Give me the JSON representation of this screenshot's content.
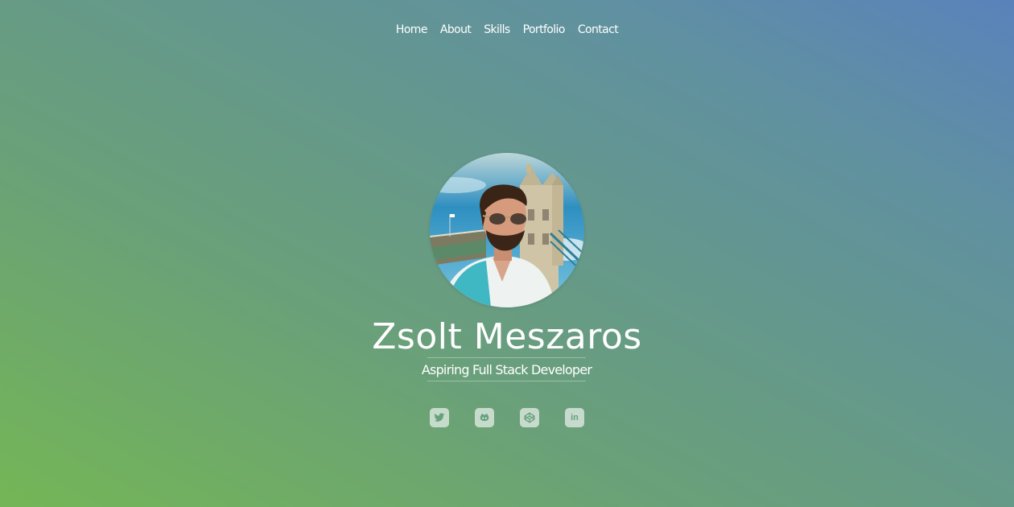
{
  "nav": {
    "items": [
      {
        "label": "Home"
      },
      {
        "label": "About"
      },
      {
        "label": "Skills"
      },
      {
        "label": "Portfolio"
      },
      {
        "label": "Contact"
      }
    ]
  },
  "profile": {
    "name": "Zsolt Meszaros",
    "tagline": "Aspiring Full Stack Developer"
  },
  "social": {
    "icons": [
      "twitter-icon",
      "github-icon",
      "codepen-icon",
      "linkedin-icon"
    ],
    "linkedin_text": "in"
  },
  "colors": {
    "gradient_start": "#74b656",
    "gradient_end": "#5a82bb",
    "text": "#ffffff",
    "icon_color": "#69a07c"
  }
}
